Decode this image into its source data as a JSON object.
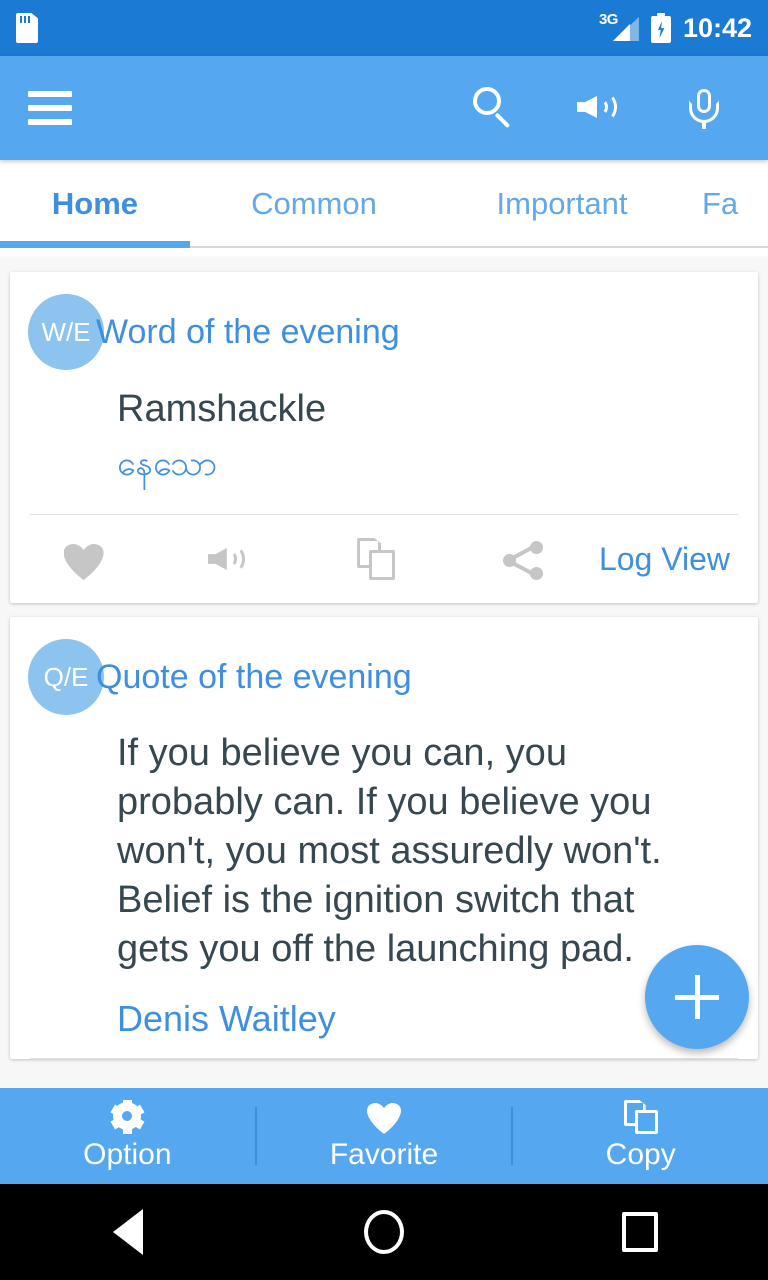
{
  "status_bar": {
    "sd_icon": "sd-card-icon",
    "network_label": "3G",
    "battery_icon": "battery-charging-icon",
    "time": "10:42"
  },
  "app_bar": {
    "menu_icon": "hamburger-menu-icon",
    "actions": [
      {
        "name": "search-icon",
        "label": "Search"
      },
      {
        "name": "volume-icon",
        "label": "Volume"
      },
      {
        "name": "mic-icon",
        "label": "Microphone"
      }
    ]
  },
  "tabs": {
    "items": [
      {
        "label": "Home",
        "active": true
      },
      {
        "label": "Common",
        "active": false
      },
      {
        "label": "Important",
        "active": false
      },
      {
        "label": "Fa",
        "active": false
      }
    ]
  },
  "cards": {
    "word": {
      "badge": "W/E",
      "title": "Word of the evening",
      "word": "Ramshackle",
      "translation": "နေသော",
      "actions": [
        {
          "name": "favorite-icon",
          "label": "Favorite"
        },
        {
          "name": "speaker-icon",
          "label": "Pronounce"
        },
        {
          "name": "copy-icon",
          "label": "Copy"
        },
        {
          "name": "share-icon",
          "label": "Share"
        }
      ],
      "log_view_label": "Log View"
    },
    "quote": {
      "badge": "Q/E",
      "title": "Quote of the evening",
      "text": "If you believe you can, you probably can. If you believe you won't, you most assuredly won't. Belief is the ignition switch that gets you off the launching pad.",
      "author": "Denis Waitley"
    }
  },
  "fab": {
    "name": "add-button",
    "label": "+"
  },
  "bottom_bar": {
    "items": [
      {
        "label": "Option",
        "icon": "gear-icon"
      },
      {
        "label": "Favorite",
        "icon": "heart-icon"
      },
      {
        "label": "Copy",
        "icon": "copy-icon"
      }
    ]
  },
  "nav_bar": {
    "back": "back-icon",
    "home": "home-icon",
    "recents": "recents-icon"
  },
  "colors": {
    "status_bar": "#1a7ad4",
    "app_bar": "#55a8ef",
    "accent": "#3f8fe0",
    "badge": "#8cc3ef",
    "text_dark": "#37474f",
    "icon_gray": "#c6c6c6"
  }
}
